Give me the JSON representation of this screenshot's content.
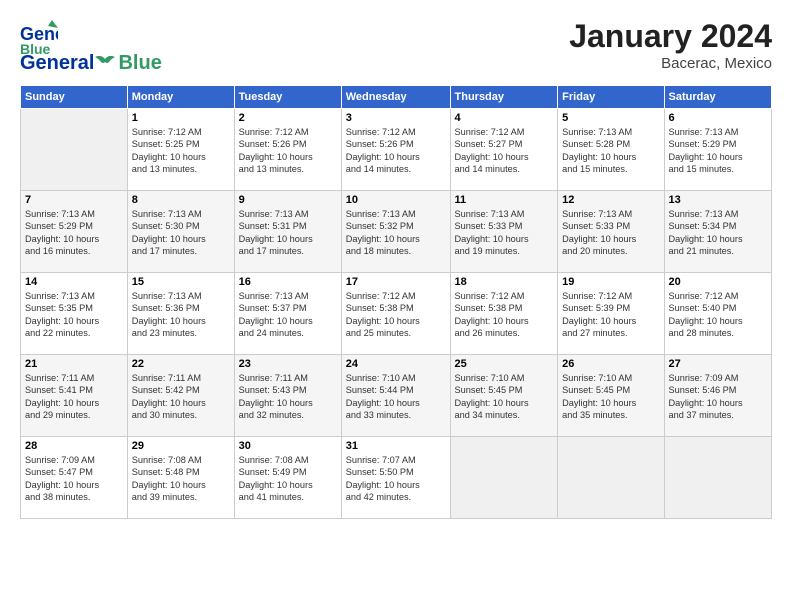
{
  "header": {
    "logo_general": "General",
    "logo_blue": "Blue",
    "month_year": "January 2024",
    "location": "Bacerac, Mexico"
  },
  "days_of_week": [
    "Sunday",
    "Monday",
    "Tuesday",
    "Wednesday",
    "Thursday",
    "Friday",
    "Saturday"
  ],
  "weeks": [
    [
      {
        "day": "",
        "info": ""
      },
      {
        "day": "1",
        "info": "Sunrise: 7:12 AM\nSunset: 5:25 PM\nDaylight: 10 hours\nand 13 minutes."
      },
      {
        "day": "2",
        "info": "Sunrise: 7:12 AM\nSunset: 5:26 PM\nDaylight: 10 hours\nand 13 minutes."
      },
      {
        "day": "3",
        "info": "Sunrise: 7:12 AM\nSunset: 5:26 PM\nDaylight: 10 hours\nand 14 minutes."
      },
      {
        "day": "4",
        "info": "Sunrise: 7:12 AM\nSunset: 5:27 PM\nDaylight: 10 hours\nand 14 minutes."
      },
      {
        "day": "5",
        "info": "Sunrise: 7:13 AM\nSunset: 5:28 PM\nDaylight: 10 hours\nand 15 minutes."
      },
      {
        "day": "6",
        "info": "Sunrise: 7:13 AM\nSunset: 5:29 PM\nDaylight: 10 hours\nand 15 minutes."
      }
    ],
    [
      {
        "day": "7",
        "info": "Sunrise: 7:13 AM\nSunset: 5:29 PM\nDaylight: 10 hours\nand 16 minutes."
      },
      {
        "day": "8",
        "info": "Sunrise: 7:13 AM\nSunset: 5:30 PM\nDaylight: 10 hours\nand 17 minutes."
      },
      {
        "day": "9",
        "info": "Sunrise: 7:13 AM\nSunset: 5:31 PM\nDaylight: 10 hours\nand 17 minutes."
      },
      {
        "day": "10",
        "info": "Sunrise: 7:13 AM\nSunset: 5:32 PM\nDaylight: 10 hours\nand 18 minutes."
      },
      {
        "day": "11",
        "info": "Sunrise: 7:13 AM\nSunset: 5:33 PM\nDaylight: 10 hours\nand 19 minutes."
      },
      {
        "day": "12",
        "info": "Sunrise: 7:13 AM\nSunset: 5:33 PM\nDaylight: 10 hours\nand 20 minutes."
      },
      {
        "day": "13",
        "info": "Sunrise: 7:13 AM\nSunset: 5:34 PM\nDaylight: 10 hours\nand 21 minutes."
      }
    ],
    [
      {
        "day": "14",
        "info": "Sunrise: 7:13 AM\nSunset: 5:35 PM\nDaylight: 10 hours\nand 22 minutes."
      },
      {
        "day": "15",
        "info": "Sunrise: 7:13 AM\nSunset: 5:36 PM\nDaylight: 10 hours\nand 23 minutes."
      },
      {
        "day": "16",
        "info": "Sunrise: 7:13 AM\nSunset: 5:37 PM\nDaylight: 10 hours\nand 24 minutes."
      },
      {
        "day": "17",
        "info": "Sunrise: 7:12 AM\nSunset: 5:38 PM\nDaylight: 10 hours\nand 25 minutes."
      },
      {
        "day": "18",
        "info": "Sunrise: 7:12 AM\nSunset: 5:38 PM\nDaylight: 10 hours\nand 26 minutes."
      },
      {
        "day": "19",
        "info": "Sunrise: 7:12 AM\nSunset: 5:39 PM\nDaylight: 10 hours\nand 27 minutes."
      },
      {
        "day": "20",
        "info": "Sunrise: 7:12 AM\nSunset: 5:40 PM\nDaylight: 10 hours\nand 28 minutes."
      }
    ],
    [
      {
        "day": "21",
        "info": "Sunrise: 7:11 AM\nSunset: 5:41 PM\nDaylight: 10 hours\nand 29 minutes."
      },
      {
        "day": "22",
        "info": "Sunrise: 7:11 AM\nSunset: 5:42 PM\nDaylight: 10 hours\nand 30 minutes."
      },
      {
        "day": "23",
        "info": "Sunrise: 7:11 AM\nSunset: 5:43 PM\nDaylight: 10 hours\nand 32 minutes."
      },
      {
        "day": "24",
        "info": "Sunrise: 7:10 AM\nSunset: 5:44 PM\nDaylight: 10 hours\nand 33 minutes."
      },
      {
        "day": "25",
        "info": "Sunrise: 7:10 AM\nSunset: 5:45 PM\nDaylight: 10 hours\nand 34 minutes."
      },
      {
        "day": "26",
        "info": "Sunrise: 7:10 AM\nSunset: 5:45 PM\nDaylight: 10 hours\nand 35 minutes."
      },
      {
        "day": "27",
        "info": "Sunrise: 7:09 AM\nSunset: 5:46 PM\nDaylight: 10 hours\nand 37 minutes."
      }
    ],
    [
      {
        "day": "28",
        "info": "Sunrise: 7:09 AM\nSunset: 5:47 PM\nDaylight: 10 hours\nand 38 minutes."
      },
      {
        "day": "29",
        "info": "Sunrise: 7:08 AM\nSunset: 5:48 PM\nDaylight: 10 hours\nand 39 minutes."
      },
      {
        "day": "30",
        "info": "Sunrise: 7:08 AM\nSunset: 5:49 PM\nDaylight: 10 hours\nand 41 minutes."
      },
      {
        "day": "31",
        "info": "Sunrise: 7:07 AM\nSunset: 5:50 PM\nDaylight: 10 hours\nand 42 minutes."
      },
      {
        "day": "",
        "info": ""
      },
      {
        "day": "",
        "info": ""
      },
      {
        "day": "",
        "info": ""
      }
    ]
  ]
}
